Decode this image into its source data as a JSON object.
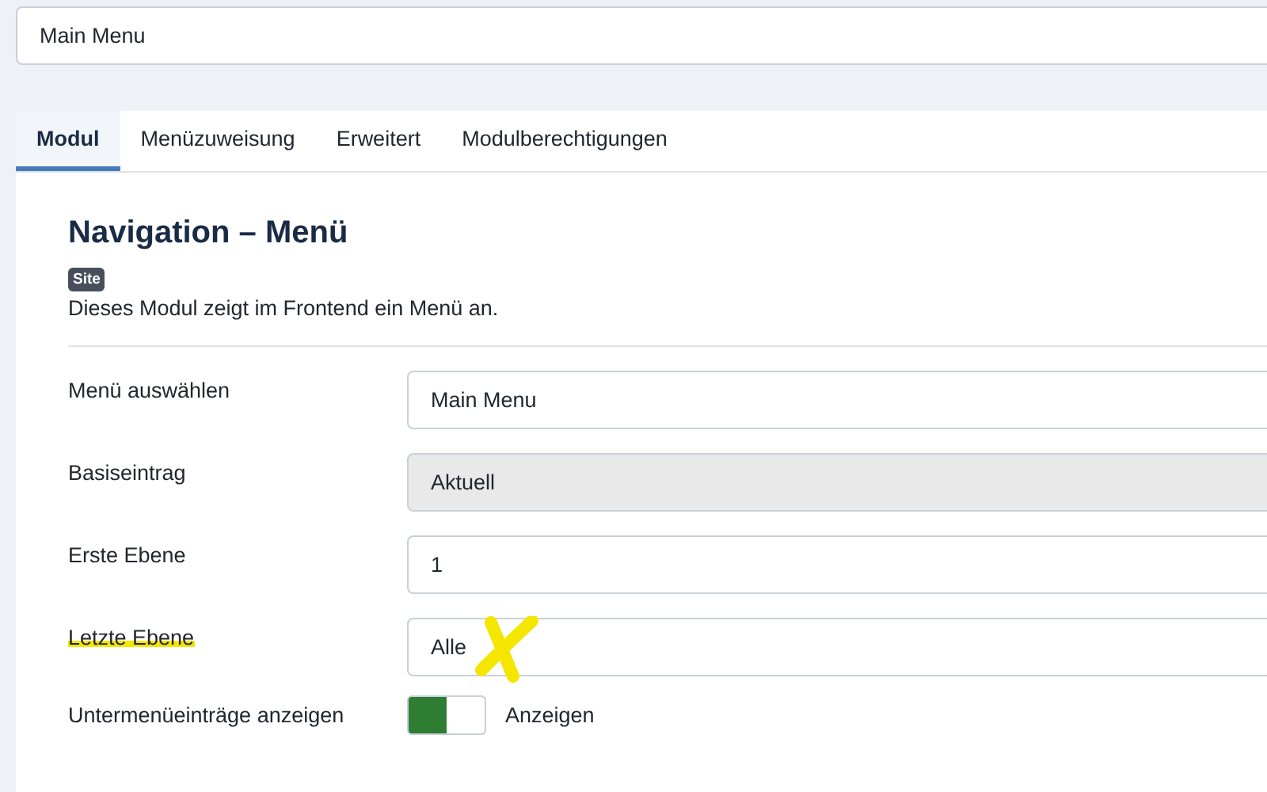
{
  "title_field": {
    "value": "Main Menu"
  },
  "tabs": [
    {
      "label": "Modul",
      "selected": true
    },
    {
      "label": "Menüzuweisung",
      "selected": false
    },
    {
      "label": "Erweitert",
      "selected": false
    },
    {
      "label": "Modulberechtigungen",
      "selected": false
    }
  ],
  "module": {
    "heading": "Navigation – Menü",
    "badge": "Site",
    "description": "Dieses Modul zeigt im Frontend ein Menü an."
  },
  "fields": [
    {
      "kind": "select",
      "label": "Menü auswählen",
      "value": "Main Menu",
      "disabled": false,
      "highlighted": false,
      "crossed": false
    },
    {
      "kind": "select",
      "label": "Basiseintrag",
      "value": "Aktuell",
      "disabled": true,
      "highlighted": false,
      "crossed": false
    },
    {
      "kind": "select",
      "label": "Erste Ebene",
      "value": "1",
      "disabled": false,
      "highlighted": false,
      "crossed": false
    },
    {
      "kind": "select",
      "label": "Letzte Ebene",
      "value": "Alle",
      "disabled": false,
      "highlighted": true,
      "crossed": true
    },
    {
      "kind": "toggle",
      "label": "Untermenüeinträge anzeigen",
      "value": "Anzeigen",
      "on": true,
      "highlighted": false,
      "crossed": false
    }
  ]
}
